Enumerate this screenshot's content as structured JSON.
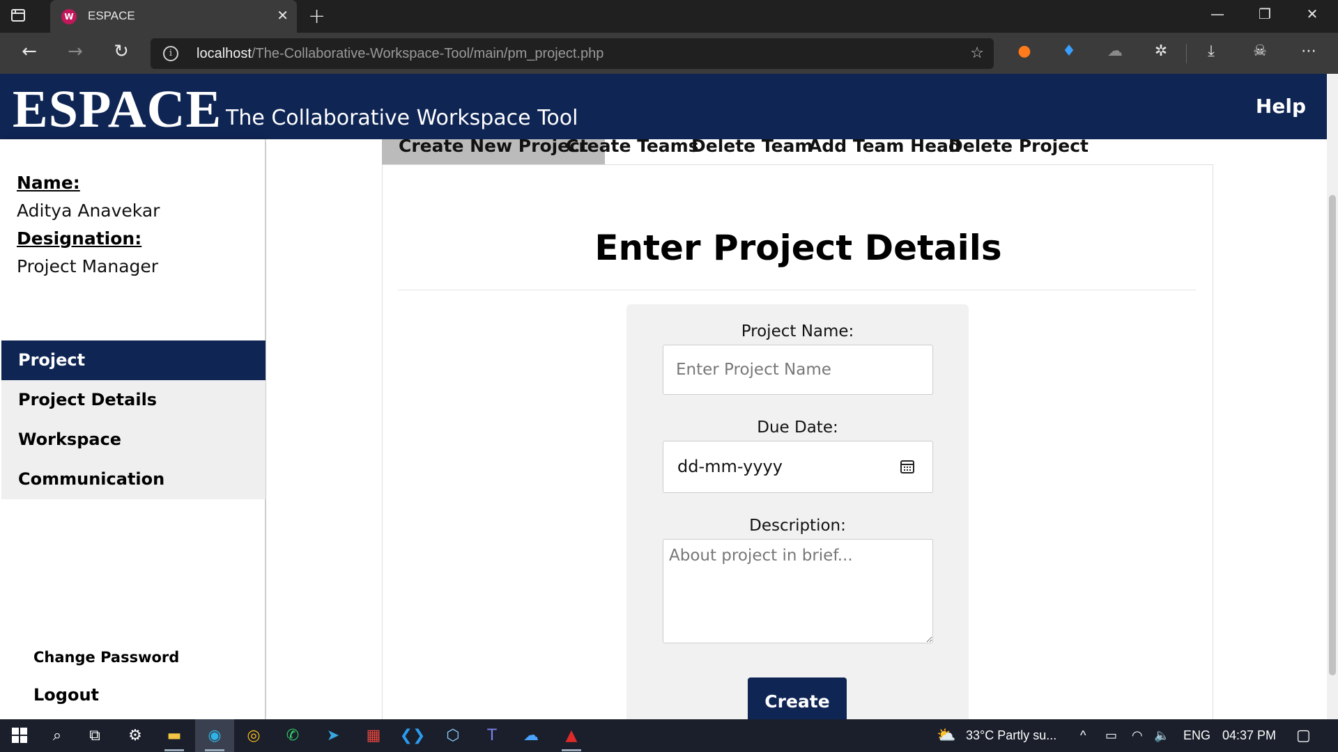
{
  "browser": {
    "tab_title": "ESPACE",
    "url_host": "localhost",
    "url_path": "/The-Collaborative-Workspace-Tool/main/pm_project.php"
  },
  "header": {
    "brand": "ESPACE",
    "tagline": "The Collaborative Workspace Tool",
    "help_label": "Help"
  },
  "sidebar": {
    "name_label": "Name:",
    "name_value": "Aditya Anavekar",
    "designation_label": "Designation:",
    "designation_value": "Project Manager",
    "menu": [
      {
        "label": "Project",
        "active": true
      },
      {
        "label": "Project Details",
        "active": false
      },
      {
        "label": "Workspace",
        "active": false
      },
      {
        "label": "Communication",
        "active": false
      }
    ],
    "change_password_label": "Change Password",
    "logout_label": "Logout"
  },
  "tabs": [
    {
      "label": "Create New Project",
      "active": true
    },
    {
      "label": "Create Teams",
      "active": false
    },
    {
      "label": "Delete Team",
      "active": false
    },
    {
      "label": "Add Team Head",
      "active": false
    },
    {
      "label": "Delete Project",
      "active": false
    }
  ],
  "form": {
    "heading": "Enter Project Details",
    "project_name_label": "Project Name:",
    "project_name_placeholder": "Enter Project Name",
    "due_date_label": "Due Date:",
    "due_date_placeholder": "dd-mm-yyyy",
    "description_label": "Description:",
    "description_placeholder": "About project in brief...",
    "create_label": "Create"
  },
  "taskbar": {
    "weather": "33°C  Partly su...",
    "language": "ENG",
    "time": "04:37 PM"
  },
  "colors": {
    "primary": "#0f2554",
    "menu_bg": "#efefef",
    "active_tab": "#bbbbbb",
    "form_card": "#f1f1f1"
  }
}
